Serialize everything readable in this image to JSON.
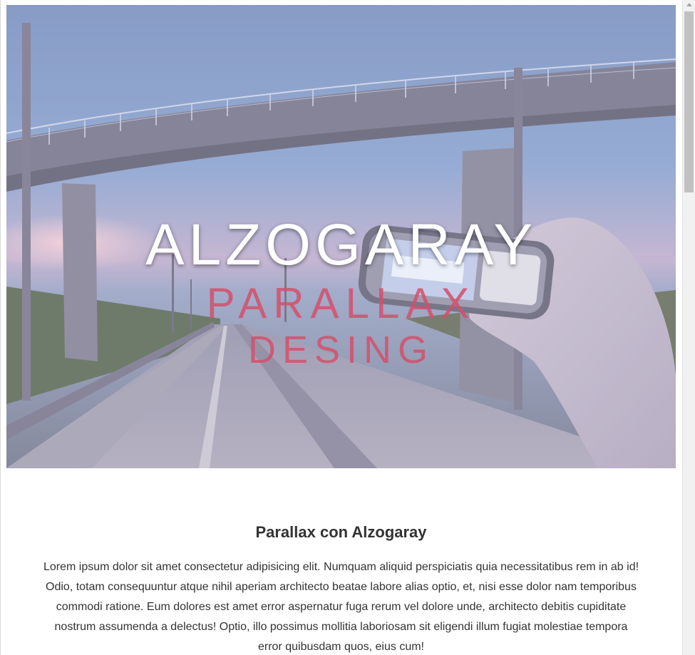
{
  "hero": {
    "title": "ALZOGARAY",
    "subtitle_line1": "PARALLAX",
    "subtitle_line2": "DESING",
    "accent_color": "#d4506c"
  },
  "content": {
    "heading": "Parallax con Alzogaray",
    "paragraph": "Lorem ipsum dolor sit amet consectetur adipisicing elit. Numquam aliquid perspiciatis quia necessitatibus rem in ab id! Odio, totam consequuntur atque nihil aperiam architecto beatae labore alias optio, et, nisi esse dolor nam temporibus commodi ratione. Eum dolores est amet error aspernatur fuga rerum vel dolore unde, architecto debitis cupiditate nostrum assumenda a delectus! Optio, illo possimus mollitia laboriosam sit eligendi illum fugiat molestiae tempora error quibusdam quos, eius cum!"
  }
}
